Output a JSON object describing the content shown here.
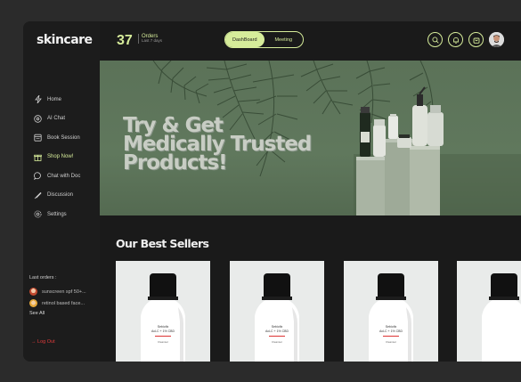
{
  "brand": {
    "logo": "skincare"
  },
  "sidebar": {
    "items": [
      {
        "label": "Home",
        "icon": "bolt-icon"
      },
      {
        "label": "AI Chat",
        "icon": "ai-chat-icon"
      },
      {
        "label": "Book Session",
        "icon": "calendar-icon"
      },
      {
        "label": "Shop Now!",
        "icon": "gift-icon",
        "active": true
      },
      {
        "label": "Chat with Doc",
        "icon": "chat-bubble-icon"
      },
      {
        "label": "Discussion",
        "icon": "discussion-icon"
      },
      {
        "label": "Settings",
        "icon": "gear-icon"
      }
    ],
    "last_orders": {
      "title": "Last orders :",
      "items": [
        {
          "label": "sunscreen spf 50+..."
        },
        {
          "label": "retinol based face..."
        }
      ],
      "see_all": "See All"
    },
    "logout": "→ Log Out"
  },
  "header": {
    "count": "37",
    "orders_title": "Orders",
    "orders_sub": "Last 7 days",
    "toggle": {
      "active": "DashBoard",
      "inactive": "Meeting"
    }
  },
  "hero": {
    "lines": [
      "Try & Get",
      "Medically Trusted",
      "Products!"
    ]
  },
  "best_sellers": {
    "title": "Our Best Sellers",
    "product": {
      "brand": "Sebiofix",
      "line2": "AcLC + 1% CBD",
      "line3": "Cleanser"
    }
  },
  "colors": {
    "accent": "#d6ec9a",
    "logout": "#e23b3b",
    "bg": "#1a1a1a"
  }
}
